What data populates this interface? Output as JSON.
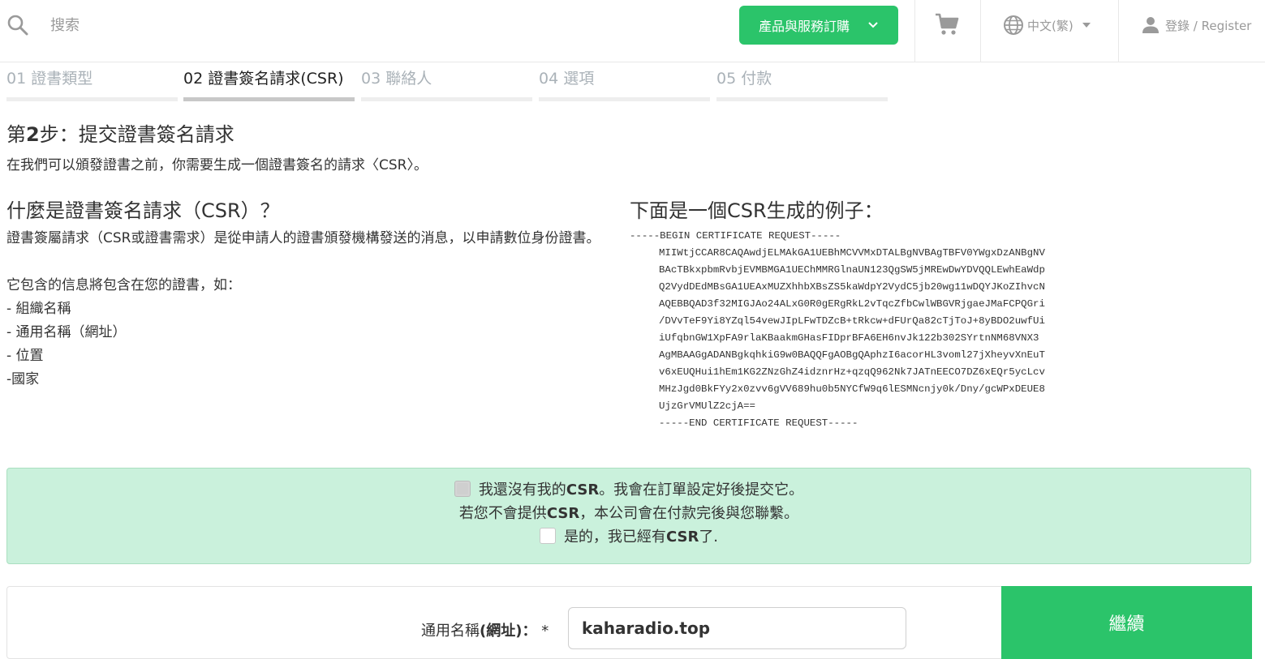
{
  "header": {
    "search": {
      "placeholder": "搜索",
      "value": ""
    },
    "products_button": "產品與服務訂購",
    "language": "中文(繁)",
    "login": "登錄 / Register"
  },
  "steps": [
    {
      "num": "01",
      "label": "證書類型",
      "active": false
    },
    {
      "num": "02",
      "label": "證書簽名請求(CSR)",
      "active": true
    },
    {
      "num": "03",
      "label": "聯絡人",
      "active": false
    },
    {
      "num": "04",
      "label": "選項",
      "active": false
    },
    {
      "num": "05",
      "label": "付款",
      "active": false
    }
  ],
  "page": {
    "title_prefix": "第",
    "title_num": "2",
    "title_suffix": "步：提交證書簽名請求",
    "subtitle": "在我們可以頒發證書之前，你需要生成一個證書簽名的請求〈CSR〉。"
  },
  "what_is": {
    "title": "什麼是證書簽名請求（CSR）？",
    "desc": "證書簽屬請求（CSR或證書需求）是從申請人的證書頒發機構發送的消息，以申請數位身份證書。",
    "intro": "它包含的信息將包含在您的證書，如：",
    "items": [
      "- 組織名稱",
      "- 通用名稱（網址）",
      "- 位置",
      "-國家"
    ]
  },
  "example": {
    "title": "下面是一個CSR生成的例子：",
    "begin": "-----BEGIN CERTIFICATE REQUEST-----",
    "lines": [
      "MIIWtjCCAR8CAQAwdjELMAkGA1UEBhMCVVMxDTALBgNVBAgTBFV0YWgxDzANBgNV",
      "BAcTBkxpbmRvbjEVMBMGA1UEChMMRGlnaUN123QgSW5jMREwDwYDVQQLEwhEaWdp",
      "Q2VydDEdMBsGA1UEAxMUZXhhbXBsZS5kaWdpY2VydC5jb20wg11wDQYJKoZIhvcN",
      "AQEBBQAD3f32MIGJAo24ALxG0R0gERgRkL2vTqcZfbCwlWBGVRjgaeJMaFCPQGri",
      "/DVvTeF9Yi8YZql54vewJIpLFwTDZcB+tRkcw+dFUrQa82cTjToJ+8yBDO2uwfUi",
      "iUfqbnGW1XpFA9rlaKBaakmGHasFIDprBFA6EH6nvJk122b302SYrtnNM68VNX3",
      "AgMBAAGgADANBgkqhkiG9w0BAQQFgAOBgQAphzI6acorHL3voml27jXheyvXnEuT",
      "v6xEUQHui1hEm1KG2ZNzGhZ4idznrHz+qzqQ962Nk7JATnEECO7DZ6xEQr5ycLcv",
      "MHzJgd0BkFYy2x0zvv6gVV689hu0b5NYCfW9q6lESMNcnjy0k/Dny/gcWPxDEUE8",
      "UjzGrVMUlZ2cjA=="
    ],
    "end": "-----END CERTIFICATE REQUEST-----"
  },
  "notice": {
    "no_csr_a": "我還沒有我的",
    "no_csr_b": "CSR",
    "no_csr_c": "。我會在訂單設定好後提交它。",
    "contact_a": "若您不會提供",
    "contact_b": "CSR",
    "contact_c": "，本公司會在付款完後與您聯繫。",
    "have_csr_a": "是的，我已經有",
    "have_csr_b": "CSR",
    "have_csr_c": "了."
  },
  "form": {
    "cn_label_a": "通用名稱",
    "cn_label_b": "(網址)：",
    "cn_required": "*",
    "cn_value": "kaharadio.top",
    "continue": "繼續"
  },
  "colors": {
    "accent": "#2bc46a",
    "notice_bg": "#caf1dc",
    "step_inactive": "#aab2b8"
  }
}
